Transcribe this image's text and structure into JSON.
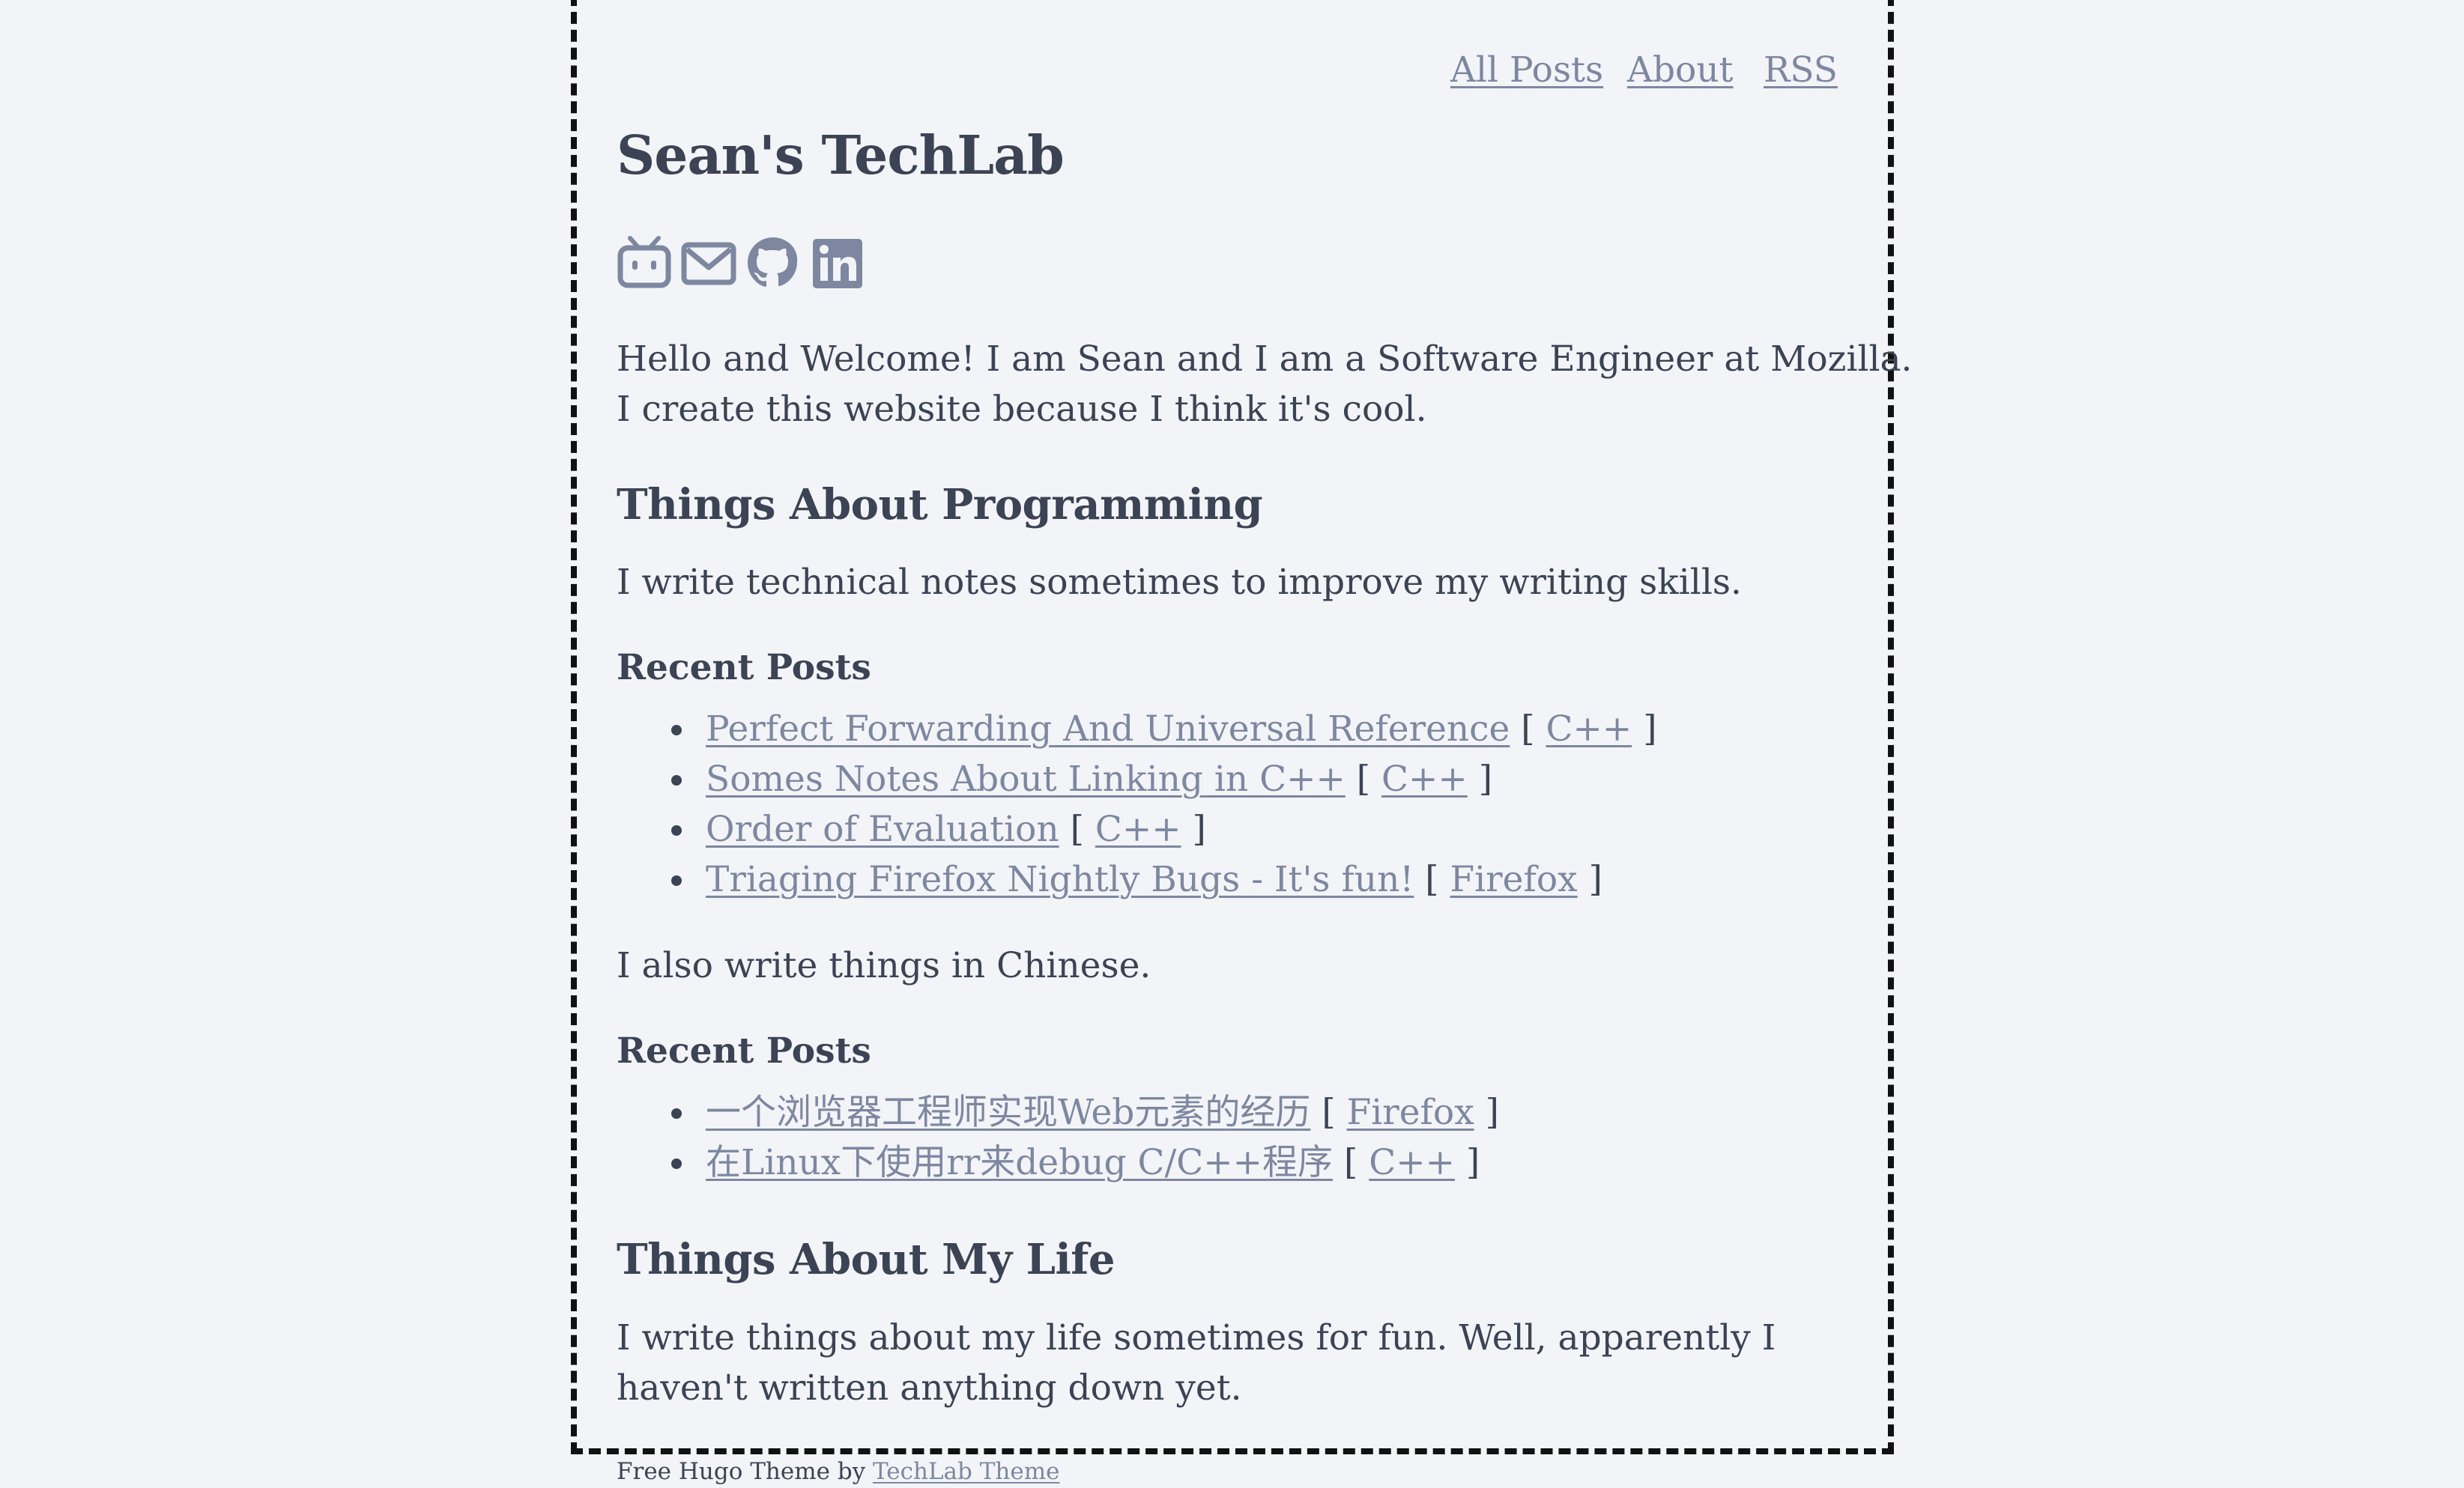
{
  "nav": {
    "all_posts": "All Posts",
    "about": "About",
    "rss": "RSS"
  },
  "site_title": "Sean's TechLab",
  "social_icons": [
    "bilibili-icon",
    "email-icon",
    "github-icon",
    "linkedin-icon"
  ],
  "intro": {
    "line1": "Hello and Welcome! I am Sean and I am a Software Engineer at Mozilla.",
    "line2": "I create this website because I think it's cool."
  },
  "programming": {
    "heading": "Things About Programming",
    "text": "I write technical notes sometimes to improve my writing skills.",
    "recent_heading": "Recent Posts",
    "posts": [
      {
        "title": "Perfect Forwarding And Universal Reference",
        "tag": "C++"
      },
      {
        "title": "Somes Notes About Linking in C++",
        "tag": "C++"
      },
      {
        "title": "Order of Evaluation",
        "tag": "C++"
      },
      {
        "title": "Triaging Firefox Nightly Bugs - It's fun!",
        "tag": "Firefox"
      }
    ]
  },
  "chinese": {
    "text": "I also write things in Chinese.",
    "recent_heading": "Recent Posts",
    "posts": [
      {
        "title": "一个浏览器工程师实现Web元素的经历",
        "tag": "Firefox"
      },
      {
        "title": "在Linux下使用rr来debug C/C++程序",
        "tag": "C++"
      }
    ]
  },
  "life": {
    "heading": "Things About My Life",
    "line1": "I write things about my life sometimes for fun. Well, apparently I",
    "line2": "haven't written anything down yet."
  },
  "footer": {
    "text": "Free Hugo Theme by ",
    "link": "TechLab Theme"
  },
  "colors": {
    "background": "#f3f4f7",
    "text": "#3b4354",
    "link": "#7d87a0",
    "border": "#111111"
  }
}
